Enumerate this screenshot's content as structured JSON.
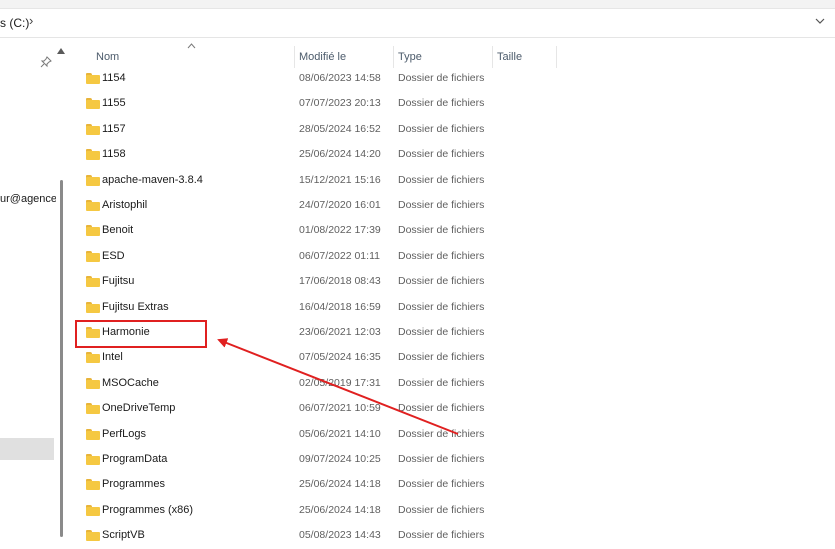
{
  "address": {
    "path": "s (C:)",
    "separator": "›",
    "dropdown_icon": "chevron-down-icon"
  },
  "nav": {
    "pin_icon": "pin-icon",
    "item_text": "ur@agencel"
  },
  "columns": {
    "name": "Nom",
    "modified": "Modifié le",
    "type": "Type",
    "size": "Taille"
  },
  "rows": [
    {
      "name": "1154",
      "date": "08/06/2023 14:58",
      "type": "Dossier de fichiers"
    },
    {
      "name": "1155",
      "date": "07/07/2023 20:13",
      "type": "Dossier de fichiers"
    },
    {
      "name": "1157",
      "date": "28/05/2024 16:52",
      "type": "Dossier de fichiers"
    },
    {
      "name": "1158",
      "date": "25/06/2024 14:20",
      "type": "Dossier de fichiers"
    },
    {
      "name": "apache-maven-3.8.4",
      "date": "15/12/2021 15:16",
      "type": "Dossier de fichiers"
    },
    {
      "name": "Aristophil",
      "date": "24/07/2020 16:01",
      "type": "Dossier de fichiers"
    },
    {
      "name": "Benoit",
      "date": "01/08/2022 17:39",
      "type": "Dossier de fichiers"
    },
    {
      "name": "ESD",
      "date": "06/07/2022 01:11",
      "type": "Dossier de fichiers"
    },
    {
      "name": "Fujitsu",
      "date": "17/06/2018 08:43",
      "type": "Dossier de fichiers"
    },
    {
      "name": "Fujitsu Extras",
      "date": "16/04/2018 16:59",
      "type": "Dossier de fichiers"
    },
    {
      "name": "Harmonie",
      "date": "23/06/2021 12:03",
      "type": "Dossier de fichiers"
    },
    {
      "name": "Intel",
      "date": "07/05/2024 16:35",
      "type": "Dossier de fichiers"
    },
    {
      "name": "MSOCache",
      "date": "02/05/2019 17:31",
      "type": "Dossier de fichiers"
    },
    {
      "name": "OneDriveTemp",
      "date": "06/07/2021 10:59",
      "type": "Dossier de fichiers"
    },
    {
      "name": "PerfLogs",
      "date": "05/06/2021 14:10",
      "type": "Dossier de fichiers"
    },
    {
      "name": "ProgramData",
      "date": "09/07/2024 10:25",
      "type": "Dossier de fichiers"
    },
    {
      "name": "Programmes",
      "date": "25/06/2024 14:18",
      "type": "Dossier de fichiers"
    },
    {
      "name": "Programmes (x86)",
      "date": "25/06/2024 14:18",
      "type": "Dossier de fichiers"
    },
    {
      "name": "ScriptVB",
      "date": "05/08/2023 14:43",
      "type": "Dossier de fichiers"
    }
  ],
  "annotation": {
    "color": "#e02020",
    "highlighted_row": "Harmonie"
  }
}
